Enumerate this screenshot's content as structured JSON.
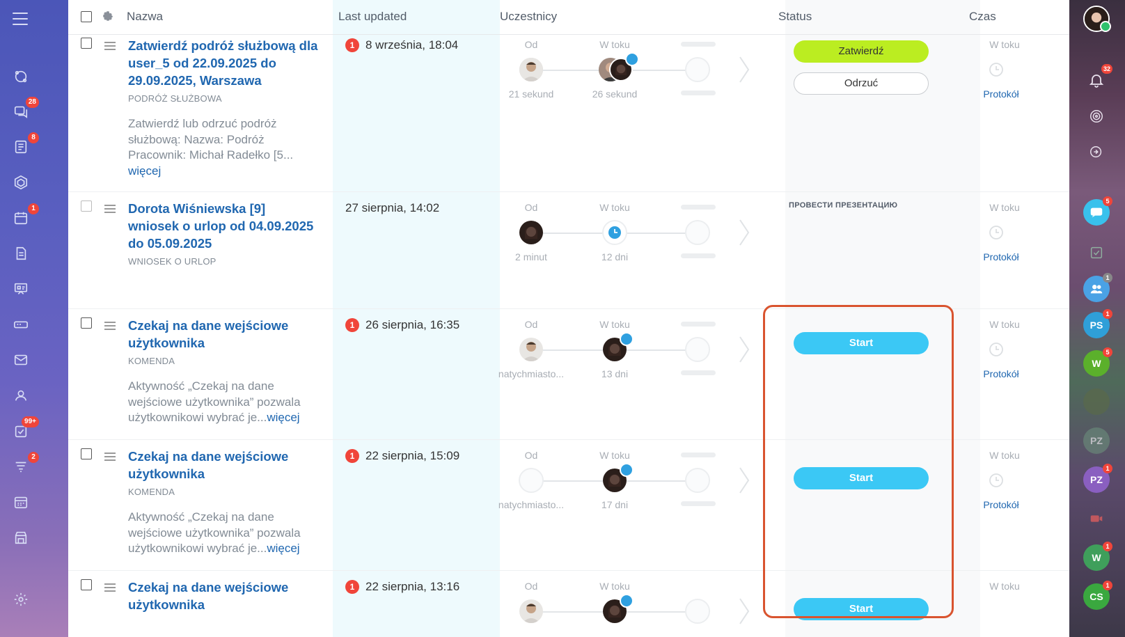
{
  "left_sidebar": {
    "badges": {
      "chats": "28",
      "feed": "8",
      "calendar": "1",
      "tasks": "99+",
      "crm": "2"
    }
  },
  "header": {
    "col_name": "Nazwa",
    "col_last_updated": "Last updated",
    "col_participants": "Uczestnicy",
    "col_status": "Status",
    "col_time": "Czas"
  },
  "labels": {
    "from": "Od",
    "in_progress": "W toku",
    "protocol": "Protokół",
    "start": "Start",
    "approve": "Zatwierdź",
    "reject": "Odrzuć",
    "more": "więcej"
  },
  "rows": [
    {
      "title": "Zatwierdź podróż służbową dla user_5 od 22.09.2025 do 29.09.2025, Warszawa",
      "type": "PODRÓŻ SŁUŻBOWA",
      "desc": "Zatwierdź lub odrzuć podróż służbową: Nazwa: Podróż Pracownik: Michał Radełko [5...",
      "date": "8 września, 18:04",
      "date_badge": "1",
      "from_time": "21 sekund",
      "progress_time": "26 sekund"
    },
    {
      "title": "Dorota Wiśniewska [9] wniosek o urlop od 04.09.2025 do 05.09.2025",
      "type": "WNIOSEK O URLOP",
      "date": "27 sierpnia, 14:02",
      "from_time": "2 minut",
      "progress_time": "12 dni",
      "status_text": "ПРОВЕСТИ ПРЕЗЕНТАЦИЮ"
    },
    {
      "title": "Czekaj na dane wejściowe użytkownika",
      "type": "KOMENDA",
      "desc": "Aktywność „Czekaj na dane wejściowe użytkownika” pozwala użytkownikowi wybrać je...",
      "date": "26 sierpnia, 16:35",
      "date_badge": "1",
      "from_time": "natychmiasto...",
      "progress_time": "13 dni"
    },
    {
      "title": "Czekaj na dane wejściowe użytkownika",
      "type": "KOMENDA",
      "desc": "Aktywność „Czekaj na dane wejściowe użytkownika” pozwala użytkownikowi wybrać je...",
      "date": "22 sierpnia, 15:09",
      "date_badge": "1",
      "from_time": "natychmiasto...",
      "progress_time": "17 dni"
    },
    {
      "title": "Czekaj na dane wejściowe użytkownika",
      "date": "22 sierpnia, 13:16",
      "date_badge": "1"
    }
  ],
  "right_sidebar": {
    "notifications_badge": "32",
    "chat_badge": "5",
    "group_badge": "1",
    "ps": {
      "label": "PS",
      "badge": "1",
      "color": "#2f9fd8"
    },
    "w1": {
      "label": "W",
      "badge": "5",
      "color": "#5bb02b"
    },
    "pz1": {
      "label": "PZ",
      "color": "#6c8f7c"
    },
    "pz2": {
      "label": "PZ",
      "badge": "1",
      "color": "#8a5fc0"
    },
    "w2": {
      "label": "W",
      "badge": "1",
      "color": "#3f9f5b"
    },
    "cs": {
      "label": "CS",
      "badge": "1",
      "color": "#3aa83f"
    }
  }
}
